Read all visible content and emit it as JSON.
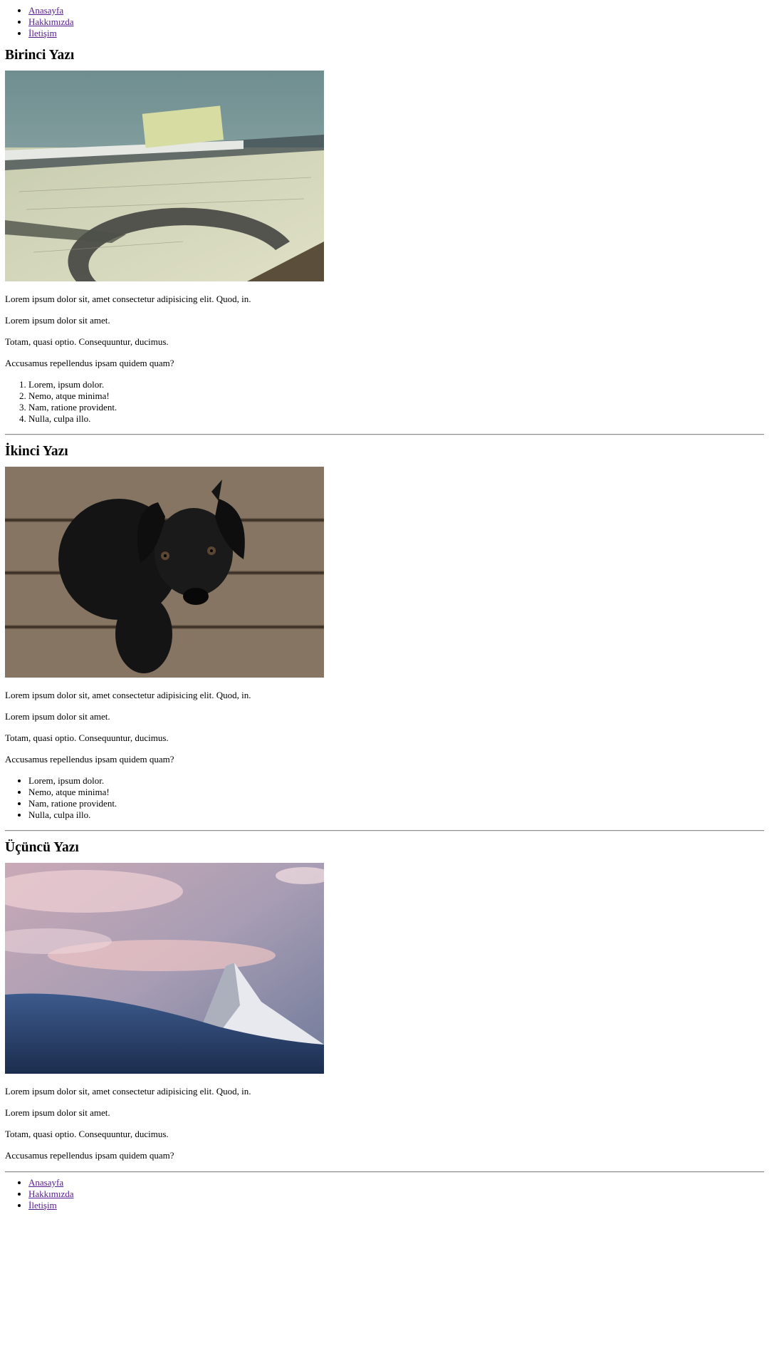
{
  "nav_top": {
    "items": [
      "Anasayfa",
      "Hakkımızda",
      "İletişim"
    ]
  },
  "posts": [
    {
      "title": "Birinci Yazı",
      "image_alt": "blueprint-table-photo",
      "paragraphs": [
        "Lorem ipsum dolor sit, amet consectetur adipisicing elit. Quod, in.",
        "Lorem ipsum dolor sit amet.",
        "Totam, quasi optio. Consequuntur, ducimus.",
        "Accusamus repellendus ipsam quidem quam?"
      ],
      "list": [
        "Lorem, ipsum dolor.",
        "Nemo, atque minima!",
        "Nam, ratione provident.",
        "Nulla, culpa illo."
      ]
    },
    {
      "title": "İkinci Yazı",
      "image_alt": "black-puppy-photo",
      "paragraphs": [
        "Lorem ipsum dolor sit, amet consectetur adipisicing elit. Quod, in.",
        "Lorem ipsum dolor sit amet.",
        "Totam, quasi optio. Consequuntur, ducimus.",
        "Accusamus repellendus ipsam quidem quam?"
      ],
      "list": [
        "Lorem, ipsum dolor.",
        "Nemo, atque minima!",
        "Nam, ratione provident.",
        "Nulla, culpa illo."
      ]
    },
    {
      "title": "Üçüncü Yazı",
      "image_alt": "mountain-sunset-photo",
      "paragraphs": [
        "Lorem ipsum dolor sit, amet consectetur adipisicing elit. Quod, in.",
        "Lorem ipsum dolor sit amet.",
        "Totam, quasi optio. Consequuntur, ducimus.",
        "Accusamus repellendus ipsam quidem quam?"
      ]
    }
  ],
  "nav_bottom": {
    "items": [
      "Anasayfa",
      "Hakkımızda",
      "İletişim"
    ]
  },
  "colors": {
    "link": "#551a8b",
    "rule": "#8c8c8c"
  }
}
